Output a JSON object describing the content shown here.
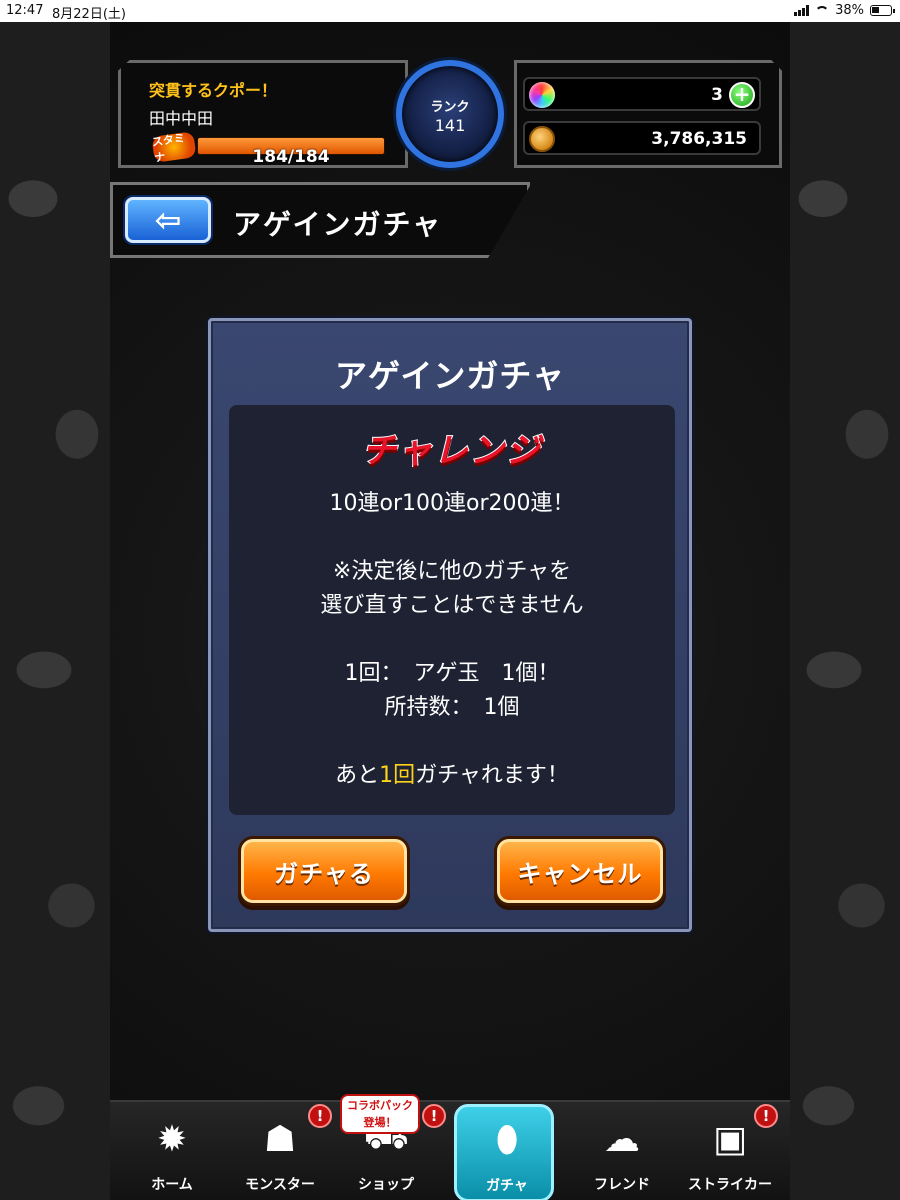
{
  "status_bar": {
    "time": "12:47",
    "date": "8月22日(土)",
    "battery": "38%"
  },
  "header": {
    "title": "突貫するクポー！",
    "player_name": "田中中田",
    "stamina_label": "スタミナ",
    "stamina_text": "184/184",
    "stamina_fraction": 1.0,
    "rank_label": "ランク",
    "rank_value": "141",
    "gems": "3",
    "coins": "3,786,315",
    "plus_label": "+"
  },
  "backbar": {
    "back_arrow": "⇦",
    "title": "アゲインガチャ"
  },
  "dialog": {
    "title": "アゲインガチャ",
    "challenge": "チャレンジ",
    "line1": "10連or100連or200連！",
    "line2": "※決定後に他のガチャを",
    "line3": "選び直すことはできません",
    "line4": "1回：　アゲ玉　1個！",
    "line5": "所持数：　1個",
    "line6_prefix": "あと",
    "line6_highlight": "1回",
    "line6_suffix": "ガチャれます！",
    "gacha_button": "ガチャる",
    "cancel_button": "キャンセル"
  },
  "tabbar": {
    "home": "ホーム",
    "monster": "モンスター",
    "shop": "ショップ",
    "gacha": "ガチャ",
    "friend": "フレンド",
    "striker": "ストライカー",
    "collab_badge_line1": "コラボパック",
    "collab_badge_line2": "登場！",
    "alert_mark": "!"
  },
  "colors": {
    "accent_blue": "#2f74e0",
    "title_gold": "#ffc21a",
    "highlight": "#ffd21a",
    "button_orange": "#ff7a00",
    "challenge_red": "#e8142a",
    "active_tab": "#3ed0e8"
  },
  "icons": [
    "gem-icon",
    "coin-icon",
    "plus-icon",
    "back-arrow-icon",
    "home-icon",
    "monster-icon",
    "cart-icon",
    "egg-icon",
    "friend-icon",
    "card-icon",
    "alert-icon"
  ]
}
